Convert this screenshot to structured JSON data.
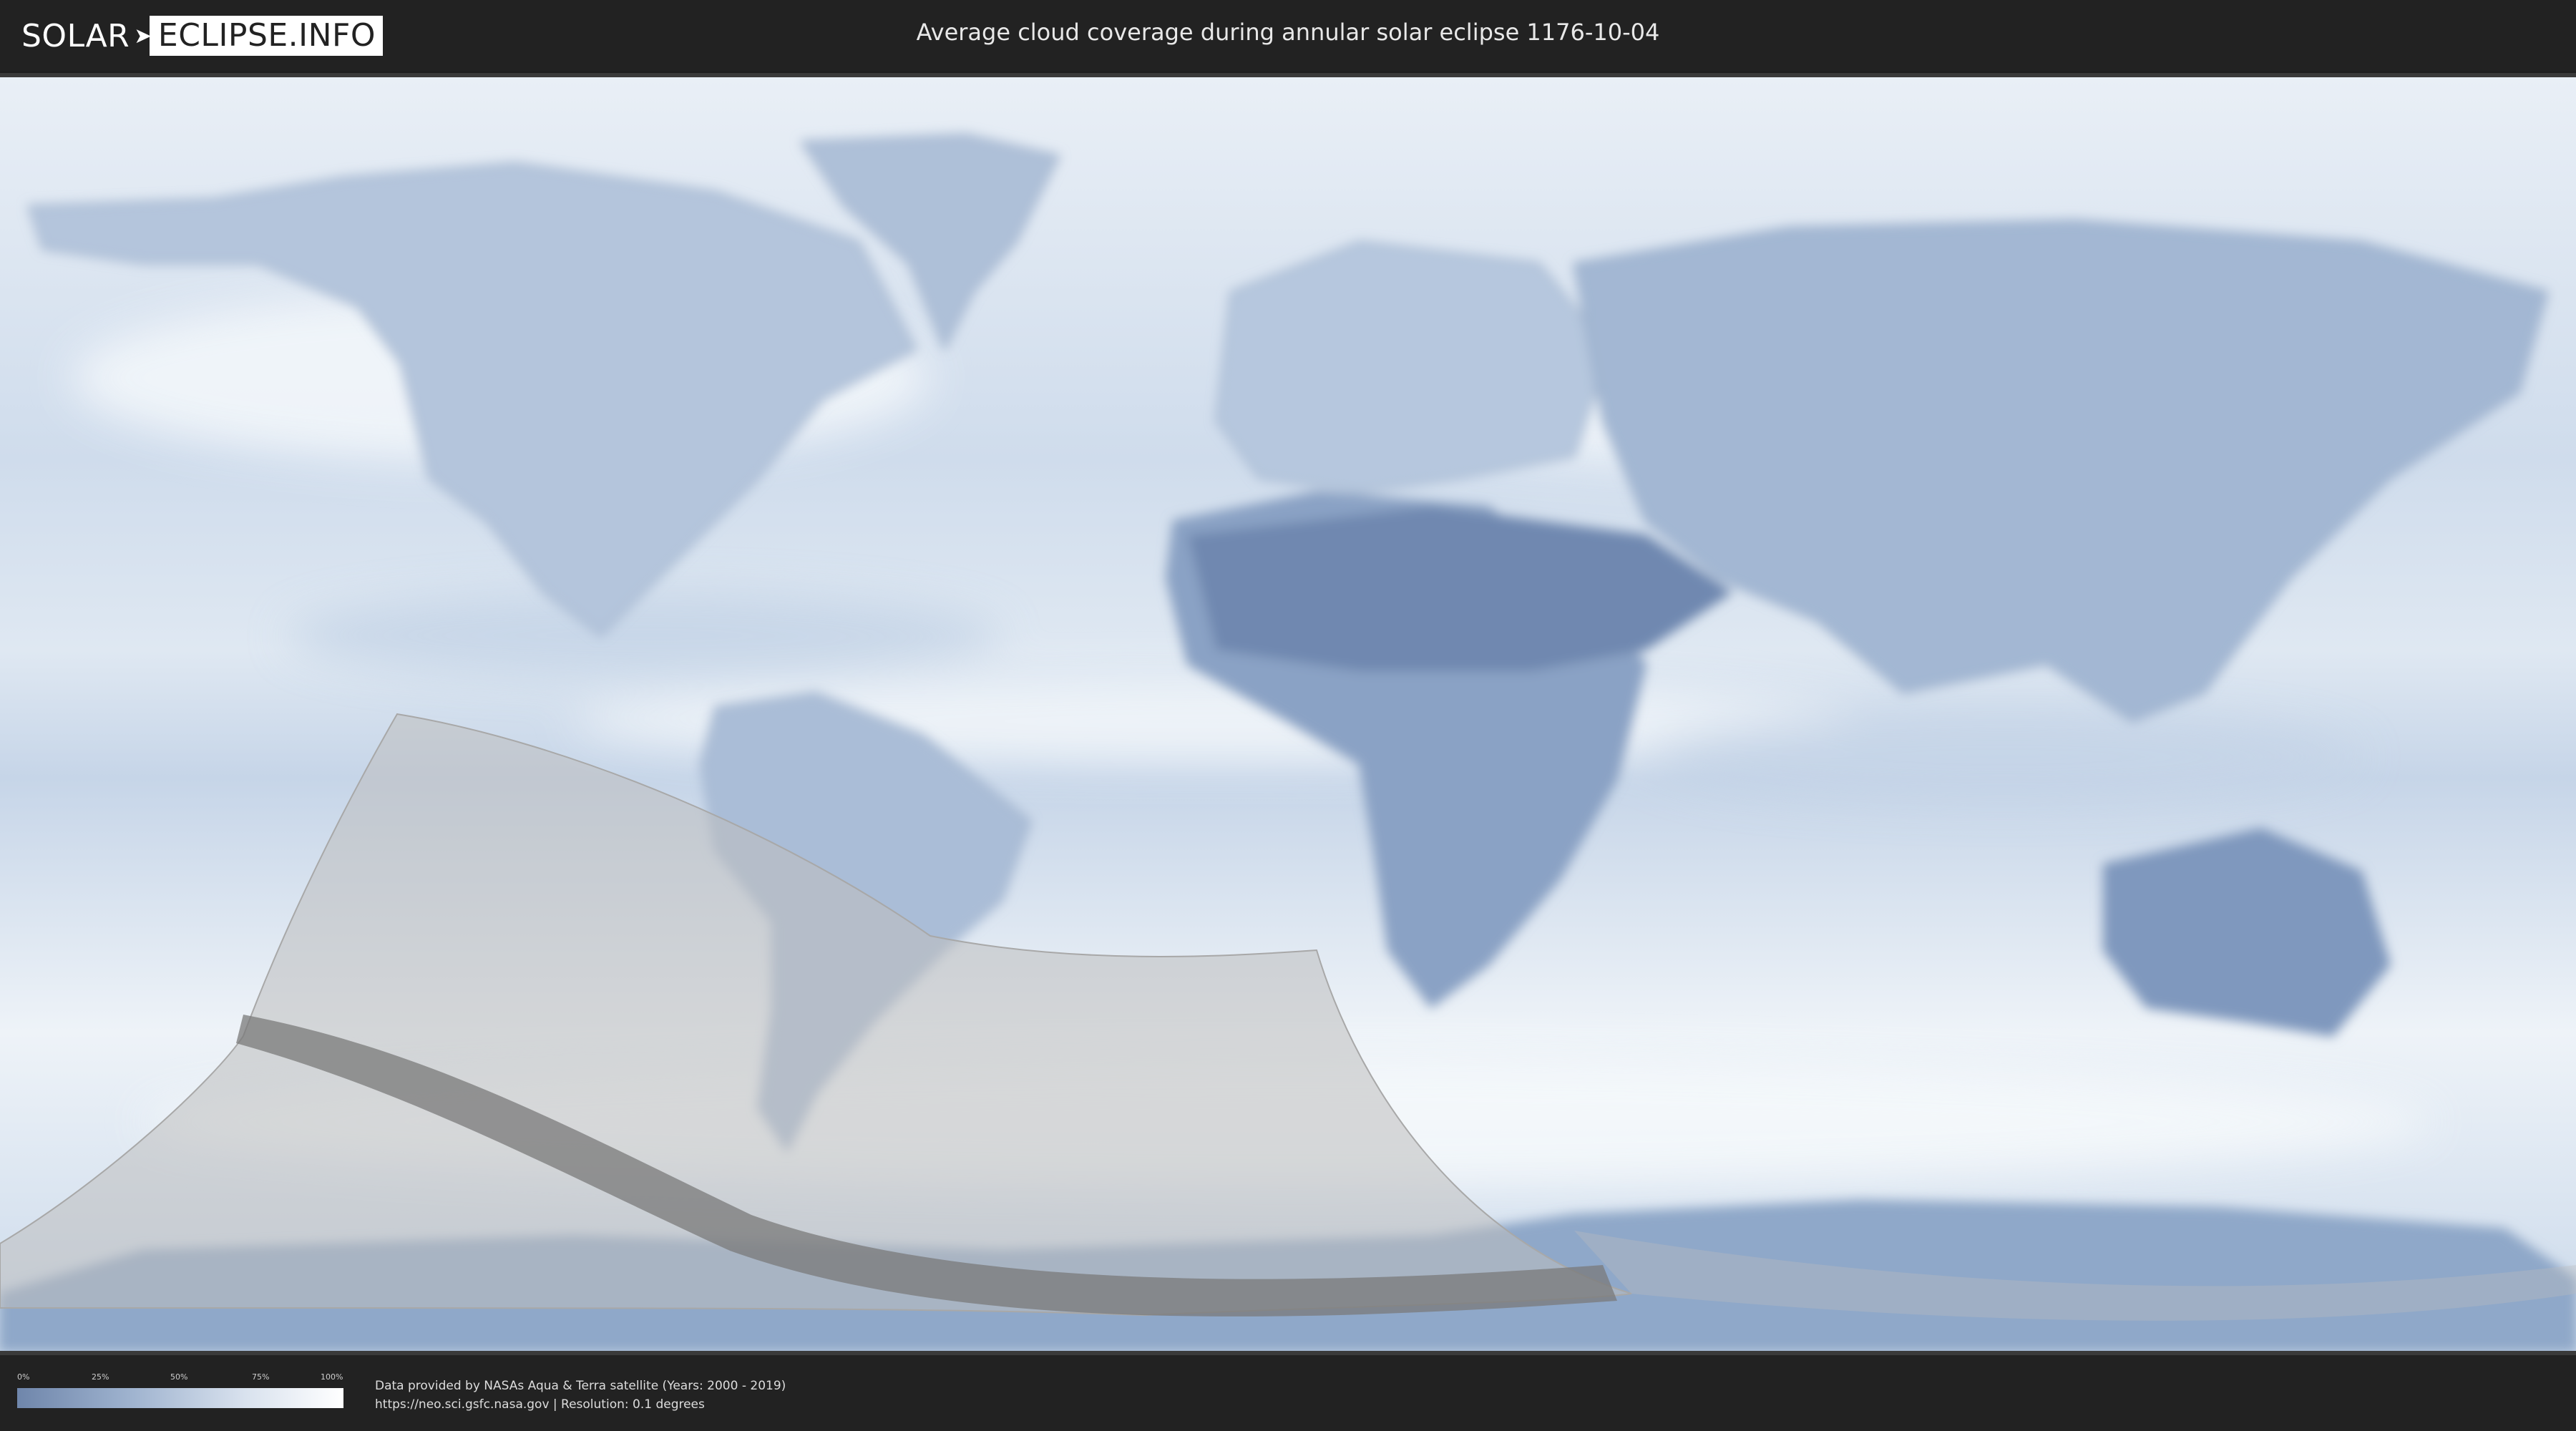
{
  "header": {
    "logo_part1": "SOLAR",
    "logo_part2": "ECLIPSE.INFO",
    "title": "Average cloud coverage during annular solar eclipse 1176-10-04"
  },
  "legend": {
    "ticks": [
      "0%",
      "25%",
      "50%",
      "75%",
      "100%"
    ],
    "colors": {
      "low": "#6f86ab",
      "high": "#ffffff"
    }
  },
  "footer": {
    "line1": "Data provided by NASAs Aqua & Terra satellite (Years: 2000 - 2019)",
    "line2": "https://neo.sci.gsfc.nasa.gov | Resolution: 0.1 degrees"
  },
  "map": {
    "ocean_color": "#dbe6f1",
    "land_color": "#8da5c6",
    "eclipse_zone_color": "#b9b9b9",
    "central_path_color": "#7e7e7e"
  }
}
